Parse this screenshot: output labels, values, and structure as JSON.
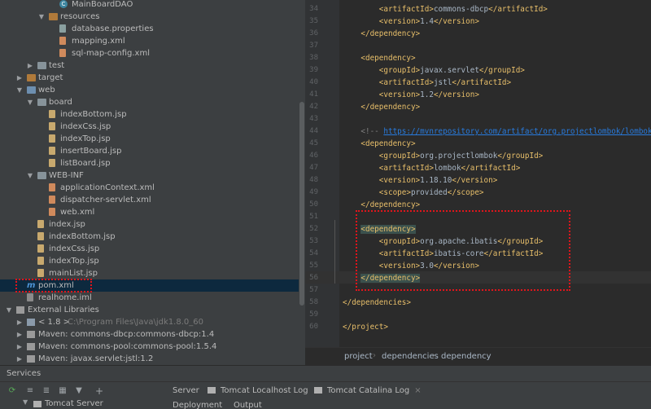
{
  "project_tree": {
    "items": [
      {
        "label": "MainBoardDAO",
        "icon": "class-icon"
      },
      {
        "label": "resources",
        "icon": "folder-icon"
      },
      {
        "label": "database.properties",
        "icon": "properties-file-icon"
      },
      {
        "label": "mapping.xml",
        "icon": "xml-file-icon"
      },
      {
        "label": "sql-map-config.xml",
        "icon": "xml-file-icon"
      },
      {
        "label": "test",
        "icon": "folder-icon"
      },
      {
        "label": "target",
        "icon": "folder-icon"
      },
      {
        "label": "web",
        "icon": "folder-icon"
      },
      {
        "label": "board",
        "icon": "folder-icon"
      },
      {
        "label": "indexBottom.jsp",
        "icon": "jsp-file-icon"
      },
      {
        "label": "indexCss.jsp",
        "icon": "jsp-file-icon"
      },
      {
        "label": "indexTop.jsp",
        "icon": "jsp-file-icon"
      },
      {
        "label": "insertBoard.jsp",
        "icon": "jsp-file-icon"
      },
      {
        "label": "listBoard.jsp",
        "icon": "jsp-file-icon"
      },
      {
        "label": "WEB-INF",
        "icon": "folder-icon"
      },
      {
        "label": "applicationContext.xml",
        "icon": "xml-file-icon"
      },
      {
        "label": "dispatcher-servlet.xml",
        "icon": "xml-file-icon"
      },
      {
        "label": "web.xml",
        "icon": "xml-file-icon"
      },
      {
        "label": "index.jsp",
        "icon": "jsp-file-icon"
      },
      {
        "label": "indexBottom.jsp",
        "icon": "jsp-file-icon"
      },
      {
        "label": "indexCss.jsp",
        "icon": "jsp-file-icon"
      },
      {
        "label": "indexTop.jsp",
        "icon": "jsp-file-icon"
      },
      {
        "label": "mainList.jsp",
        "icon": "jsp-file-icon"
      },
      {
        "label": "pom.xml",
        "icon": "maven-icon"
      },
      {
        "label": "realhome.iml",
        "icon": "iml-file-icon"
      },
      {
        "label": "External Libraries",
        "icon": "library-icon"
      },
      {
        "label": "< 1.8 >",
        "suffix": "C:\\Program Files\\Java\\jdk1.8.0_60",
        "icon": "jdk-icon"
      },
      {
        "label": "Maven: commons-dbcp:commons-dbcp:1.4",
        "icon": "library-icon"
      },
      {
        "label": "Maven: commons-pool:commons-pool:1.5.4",
        "icon": "library-icon"
      },
      {
        "label": "Maven: javax.servlet:jstl:1.2",
        "icon": "library-icon"
      }
    ]
  },
  "editor": {
    "line_numbers": [
      "34",
      "35",
      "36",
      "37",
      "38",
      "39",
      "40",
      "41",
      "42",
      "43",
      "44",
      "45",
      "46",
      "47",
      "48",
      "49",
      "50",
      "51",
      "52",
      "53",
      "54",
      "55",
      "56",
      "57",
      "58",
      "59",
      "60"
    ],
    "lines": [
      {
        "pre": "        <artifactId>",
        "text": "commons-dbcp",
        "post": "</artifactId>"
      },
      {
        "pre": "        <version>",
        "text": "1.4",
        "post": "</version>"
      },
      {
        "pre": "    </dependency>",
        "text": "",
        "post": ""
      },
      {
        "pre": "",
        "text": "",
        "post": ""
      },
      {
        "pre": "    <dependency>",
        "text": "",
        "post": ""
      },
      {
        "pre": "        <groupId>",
        "text": "javax.servlet",
        "post": "</groupId>"
      },
      {
        "pre": "        <artifactId>",
        "text": "jstl",
        "post": "</artifactId>"
      },
      {
        "pre": "        <version>",
        "text": "1.2",
        "post": "</version>"
      },
      {
        "pre": "    </dependency>",
        "text": "",
        "post": ""
      },
      {
        "pre": "",
        "text": "",
        "post": ""
      },
      {
        "comment_start": "    <!-- ",
        "url": "https://mvnrepository.com/artifact/org.projectlombok/lombok"
      },
      {
        "pre": "    <dependency>",
        "text": "",
        "post": ""
      },
      {
        "pre": "        <groupId>",
        "text": "org.projectlombok",
        "post": "</groupId>"
      },
      {
        "pre": "        <artifactId>",
        "text": "lombok",
        "post": "</artifactId>"
      },
      {
        "pre": "        <version>",
        "text": "1.18.10",
        "post": "</version>"
      },
      {
        "pre": "        <scope>",
        "text": "provided",
        "post": "</scope>"
      },
      {
        "pre": "    </dependency>",
        "text": "",
        "post": ""
      },
      {
        "pre": "",
        "text": "",
        "post": ""
      },
      {
        "pre": "    <dependency>",
        "text": "",
        "post": ""
      },
      {
        "pre": "        <groupId>",
        "text": "org.apache.ibatis",
        "post": "</groupId>"
      },
      {
        "pre": "        <artifactId>",
        "text": "ibatis-core",
        "post": "</artifactId>"
      },
      {
        "pre": "        <version>",
        "text": "3.0",
        "post": "</version>"
      },
      {
        "pre": "    </dependency>",
        "text": "",
        "post": ""
      },
      {
        "pre": "",
        "text": "",
        "post": ""
      },
      {
        "pre": "</dependencies>",
        "text": "",
        "post": ""
      },
      {
        "pre": "",
        "text": "",
        "post": ""
      },
      {
        "pre": "</project>",
        "text": "",
        "post": ""
      }
    ]
  },
  "breadcrumb": [
    "project",
    "dependencies",
    "dependency"
  ],
  "services": {
    "title": "Services",
    "tabs": [
      {
        "label": "Server",
        "closable": false
      },
      {
        "label": "Tomcat Localhost Log",
        "closable": true
      },
      {
        "label": "Tomcat Catalina Log",
        "closable": true
      }
    ],
    "tree_item": "Tomcat Server",
    "sub_tabs": [
      "Deployment",
      "Output"
    ]
  },
  "colors": {
    "highlight_box": "#e0151b",
    "selection": "#0d293e",
    "tag": "#e8bf6a"
  }
}
